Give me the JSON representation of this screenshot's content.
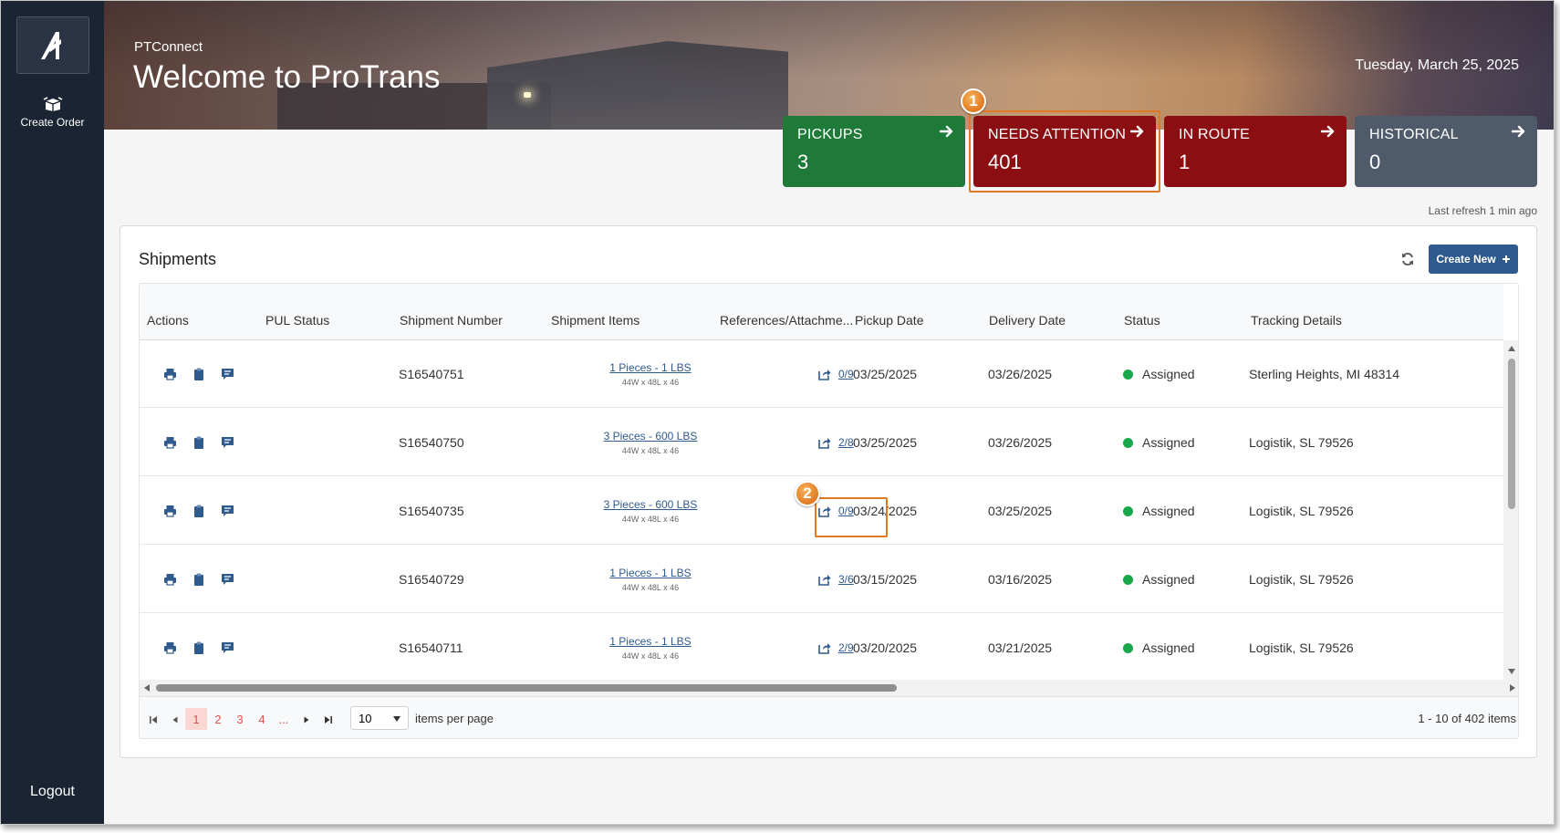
{
  "sidebar": {
    "create_order_label": "Create Order",
    "logout_label": "Logout"
  },
  "header": {
    "subtitle": "PTConnect",
    "title": "Welcome to ProTrans",
    "date": "Tuesday, March 25, 2025"
  },
  "cards": [
    {
      "label": "PICKUPS",
      "value": "3",
      "color": "#1f7a3a"
    },
    {
      "label": "NEEDS ATTENTION",
      "value": "401",
      "color": "#8b0e12"
    },
    {
      "label": "IN ROUTE",
      "value": "1",
      "color": "#8b0e12"
    },
    {
      "label": "HISTORICAL",
      "value": "0",
      "color": "#4f5b6b"
    }
  ],
  "callouts": {
    "one": "1",
    "two": "2",
    "accent": "#e07a22"
  },
  "last_refresh": "Last refresh 1 min ago",
  "shipments": {
    "title": "Shipments",
    "create_new_label": "Create New",
    "columns": [
      "Actions",
      "PUL Status",
      "Shipment Number",
      "Shipment Items",
      "References/Attachme...",
      "Pickup Date",
      "Delivery Date",
      "Status",
      "Tracking Details"
    ],
    "rows": [
      {
        "number": "S16540751",
        "items": "1 Pieces - 1 LBS",
        "dims": "44W x 48L x 46",
        "refs": "0/9",
        "pickup": "03/25/2025",
        "delivery": "03/26/2025",
        "status": "Assigned",
        "tracking": "Sterling Heights, MI 48314"
      },
      {
        "number": "S16540750",
        "items": "3 Pieces - 600 LBS",
        "dims": "44W x 48L x 46",
        "refs": "2/8",
        "pickup": "03/25/2025",
        "delivery": "03/26/2025",
        "status": "Assigned",
        "tracking": "Logistik, SL 79526"
      },
      {
        "number": "S16540735",
        "items": "3 Pieces - 600 LBS",
        "dims": "44W x 48L x 46",
        "refs": "0/9",
        "pickup": "03/24/2025",
        "delivery": "03/25/2025",
        "status": "Assigned",
        "tracking": "Logistik, SL 79526"
      },
      {
        "number": "S16540729",
        "items": "1 Pieces - 1 LBS",
        "dims": "44W x 48L x 46",
        "refs": "3/6",
        "pickup": "03/15/2025",
        "delivery": "03/16/2025",
        "status": "Assigned",
        "tracking": "Logistik, SL 79526"
      },
      {
        "number": "S16540711",
        "items": "1 Pieces - 1 LBS",
        "dims": "44W x 48L x 46",
        "refs": "2/9",
        "pickup": "03/20/2025",
        "delivery": "03/21/2025",
        "status": "Assigned",
        "tracking": "Logistik, SL 79526"
      }
    ],
    "status_color": "#18a84b",
    "link_color": "#2f5a8e"
  },
  "pager": {
    "pages": [
      "1",
      "2",
      "3",
      "4",
      "..."
    ],
    "current": "1",
    "page_size": "10",
    "per_page_label": "items per page",
    "count_label": "1 - 10 of 402 items"
  },
  "icons": [
    "logo-icon",
    "create-order-icon",
    "arrow-right-icon",
    "print-icon",
    "clipboard-icon",
    "comment-icon",
    "share-icon",
    "refresh-icon",
    "plus-icon",
    "first-page-icon",
    "prev-page-icon",
    "next-page-icon",
    "last-page-icon"
  ]
}
